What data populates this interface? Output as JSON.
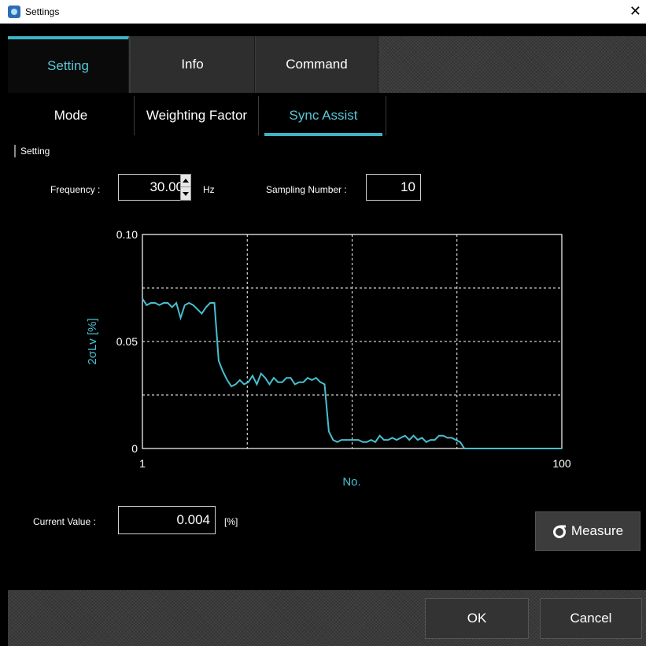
{
  "window": {
    "title": "Settings",
    "close": "✕"
  },
  "tabs": [
    {
      "label": "Setting",
      "active": true
    },
    {
      "label": "Info",
      "active": false
    },
    {
      "label": "Command",
      "active": false
    }
  ],
  "subtabs": [
    {
      "label": "Mode",
      "active": false
    },
    {
      "label": "Weighting Factor",
      "active": false
    },
    {
      "label": "Sync Assist",
      "active": true
    }
  ],
  "section": {
    "label": "Setting"
  },
  "frequency": {
    "label": "Frequency :",
    "value": "30.00",
    "unit": "Hz"
  },
  "sampling": {
    "label": "Sampling Number :",
    "value": "10"
  },
  "current": {
    "label": "Current Value :",
    "value": "0.004",
    "unit": "[%]"
  },
  "buttons": {
    "measure": "Measure",
    "ok": "OK",
    "cancel": "Cancel"
  },
  "colors": {
    "accent": "#3fb3c6",
    "line": "#48bfcf",
    "grid": "#ffffff"
  },
  "chart_data": {
    "type": "line",
    "xlabel": "No.",
    "ylabel": "2σLv [%]",
    "xlim": [
      1,
      100
    ],
    "ylim": [
      0,
      0.1
    ],
    "x_ticks": [
      "1",
      "100"
    ],
    "y_ticks": [
      "0",
      "0.05",
      "0.10"
    ],
    "grid": true,
    "series": [
      {
        "x": [
          1,
          2,
          3,
          4,
          5,
          6,
          7,
          8,
          9,
          10,
          11,
          12,
          13,
          14,
          15,
          16,
          17,
          18,
          19,
          20,
          21,
          22,
          23,
          24,
          25,
          26,
          27,
          28,
          29,
          30,
          31,
          32,
          33,
          34,
          35,
          36,
          37,
          38,
          39,
          40,
          41,
          42,
          43,
          44,
          45,
          46,
          47,
          48,
          49,
          50,
          51,
          52,
          53,
          54,
          55,
          56,
          57,
          58,
          59,
          60,
          61,
          62,
          63,
          64,
          65,
          66,
          67,
          68,
          69,
          70,
          71,
          72,
          73,
          74,
          75,
          76,
          77,
          78,
          79,
          80,
          81,
          82,
          83,
          84,
          85,
          86,
          87,
          88,
          89,
          90,
          91,
          92,
          93,
          94,
          95,
          96,
          97,
          98,
          99,
          100
        ],
        "values": [
          0.07,
          0.067,
          0.068,
          0.068,
          0.067,
          0.068,
          0.068,
          0.066,
          0.068,
          0.061,
          0.067,
          0.068,
          0.067,
          0.065,
          0.063,
          0.066,
          0.068,
          0.068,
          0.041,
          0.036,
          0.032,
          0.029,
          0.03,
          0.032,
          0.03,
          0.031,
          0.034,
          0.03,
          0.035,
          0.033,
          0.03,
          0.033,
          0.031,
          0.031,
          0.033,
          0.033,
          0.03,
          0.031,
          0.031,
          0.033,
          0.032,
          0.033,
          0.031,
          0.03,
          0.008,
          0.004,
          0.003,
          0.004,
          0.004,
          0.004,
          0.004,
          0.004,
          0.003,
          0.003,
          0.004,
          0.003,
          0.006,
          0.004,
          0.004,
          0.005,
          0.004,
          0.005,
          0.006,
          0.004,
          0.006,
          0.004,
          0.005,
          0.003,
          0.004,
          0.004,
          0.006,
          0.006,
          0.005,
          0.005,
          0.004,
          0.003,
          0,
          0,
          0,
          0,
          0,
          0,
          0,
          0,
          0,
          0,
          0,
          0,
          0,
          0,
          0,
          0,
          0,
          0,
          0,
          0,
          0,
          0,
          0,
          0
        ]
      }
    ]
  }
}
